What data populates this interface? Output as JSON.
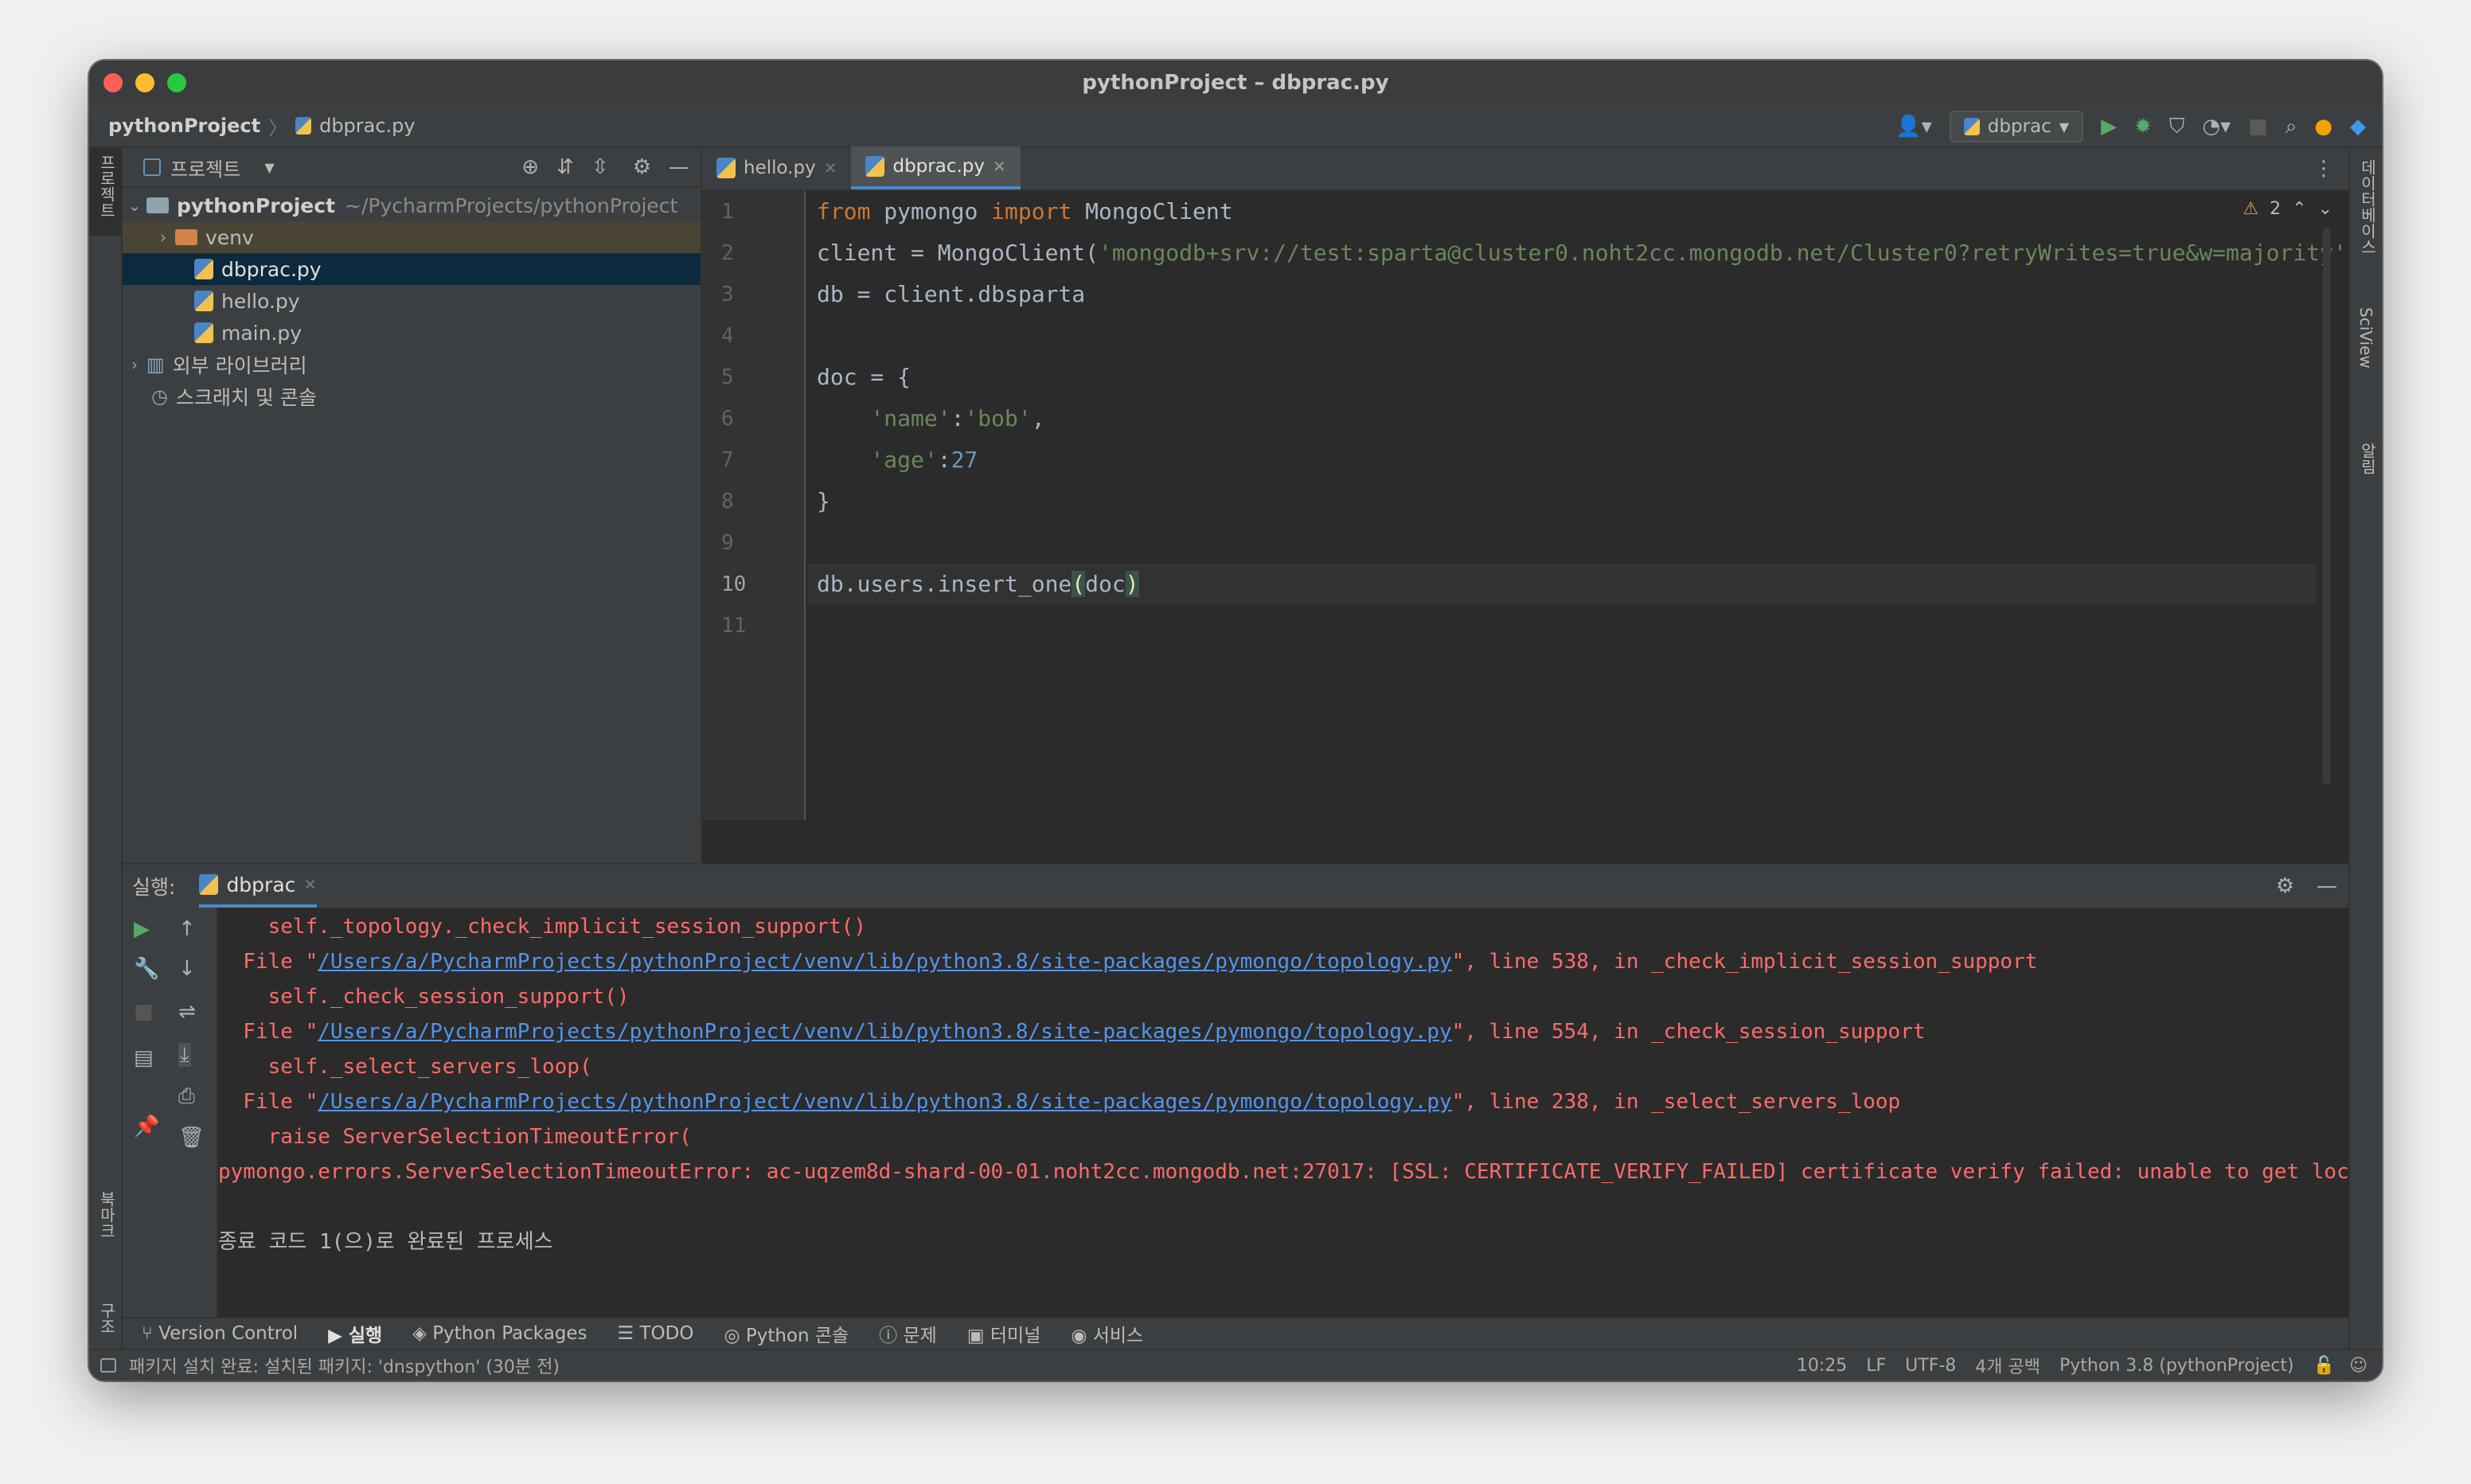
{
  "window": {
    "title": "pythonProject – dbprac.py"
  },
  "navbar": {
    "project": "pythonProject",
    "file": "dbprac.py",
    "run_config": "dbprac"
  },
  "left_strip": {
    "project_label": "프로젝트",
    "bookmarks_label": "북마크",
    "structure_label": "구조"
  },
  "right_strip": {
    "database_label": "데이터베이스",
    "sciview_label": "SciView",
    "notifications_label": "알림"
  },
  "project_panel": {
    "title": "프로젝트",
    "root": {
      "name": "pythonProject",
      "path": "~/PycharmProjects/pythonProject"
    },
    "items": [
      {
        "label": "venv",
        "kind": "folder"
      },
      {
        "label": "dbprac.py",
        "kind": "py"
      },
      {
        "label": "hello.py",
        "kind": "py"
      },
      {
        "label": "main.py",
        "kind": "py"
      }
    ],
    "external_libs": "외부 라이브러리",
    "scratches": "스크래치 및 콘솔"
  },
  "editor": {
    "tabs": [
      {
        "label": "hello.py"
      },
      {
        "label": "dbprac.py"
      }
    ],
    "warning_count": "2",
    "line_numbers": [
      "1",
      "2",
      "3",
      "4",
      "5",
      "6",
      "7",
      "8",
      "9",
      "10",
      "11"
    ],
    "code": {
      "l1_kw1": "from",
      "l1_mod": " pymongo ",
      "l1_kw2": "import",
      "l1_rest": " MongoClient",
      "l2_pre": "client = MongoClient(",
      "l2_str": "'mongodb+srv://test:sparta@cluster0.noht2cc.mongodb.net/Cluster0?retryWrites=true&w=majority'",
      "l3": "db = client.dbsparta",
      "l5": "doc = {",
      "l6_indent": "    ",
      "l6_key": "'name'",
      "l6_colon": ":",
      "l6_val": "'bob'",
      "l6_end": ",",
      "l7_indent": "    ",
      "l7_key": "'age'",
      "l7_colon": ":",
      "l7_val": "27",
      "l8": "}",
      "l10_pre": "db.users.insert_one",
      "l10_open": "(",
      "l10_arg": "doc",
      "l10_close": ")"
    }
  },
  "run_panel": {
    "label": "실행:",
    "tab": "dbprac",
    "lines": [
      {
        "pre": "    self._topology._check_implicit_session_support()"
      },
      {
        "pre": "  File \"",
        "link": "/Users/a/PycharmProjects/pythonProject/venv/lib/python3.8/site-packages/pymongo/topology.py",
        "post": "\", line 538, in _check_implicit_session_support"
      },
      {
        "pre": "    self._check_session_support()"
      },
      {
        "pre": "  File \"",
        "link": "/Users/a/PycharmProjects/pythonProject/venv/lib/python3.8/site-packages/pymongo/topology.py",
        "post": "\", line 554, in _check_session_support"
      },
      {
        "pre": "    self._select_servers_loop("
      },
      {
        "pre": "  File \"",
        "link": "/Users/a/PycharmProjects/pythonProject/venv/lib/python3.8/site-packages/pymongo/topology.py",
        "post": "\", line 238, in _select_servers_loop"
      },
      {
        "pre": "    raise ServerSelectionTimeoutError("
      },
      {
        "pre": "pymongo.errors.ServerSelectionTimeoutError: ac-uqzem8d-shard-00-01.noht2cc.mongodb.net:27017: [SSL: CERTIFICATE_VERIFY_FAILED] certificate verify failed: unable to get local issuer certificate"
      },
      {
        "pre": ""
      },
      {
        "pre": "종료 코드 1(으)로 완료된 프로세스"
      }
    ]
  },
  "bottom_tabs": [
    "Version Control",
    "실행",
    "Python Packages",
    "TODO",
    "Python 콘솔",
    "문제",
    "터미널",
    "서비스"
  ],
  "status": {
    "message": "패키지 설치 완료: 설치된 패키지: 'dnspython' (30분 전)",
    "position": "10:25",
    "line_sep": "LF",
    "encoding": "UTF-8",
    "indent": "4개 공백",
    "interpreter": "Python 3.8 (pythonProject)"
  },
  "colors": {
    "accent": "#4a88c7",
    "error": "#ff6b68",
    "link": "#5394ec",
    "keyword": "#cc7832",
    "string": "#6a8759",
    "number": "#6897bb"
  }
}
